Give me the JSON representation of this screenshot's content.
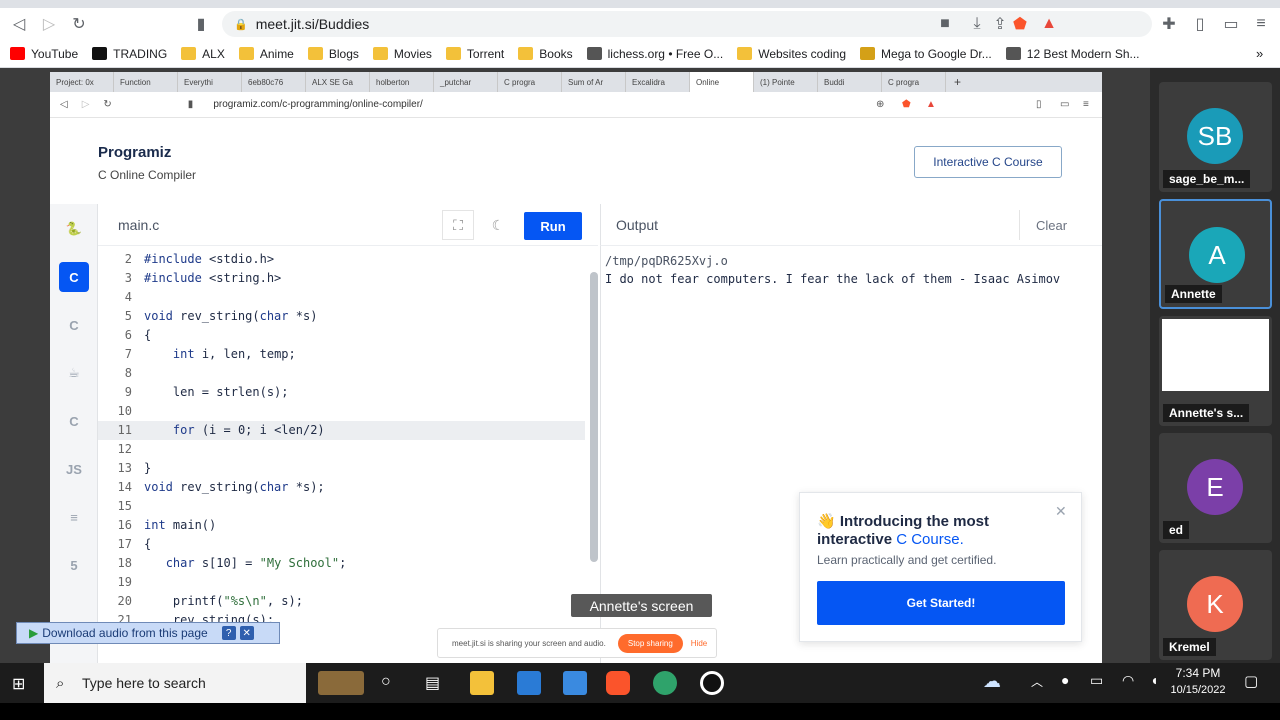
{
  "outer_browser": {
    "url": "meet.jit.si/Buddies",
    "bookmarks": [
      "YouTube",
      "TRADING",
      "ALX",
      "Anime",
      "Blogs",
      "Movies",
      "Torrent",
      "Books",
      "lichess.org • Free O...",
      "Websites coding",
      "Mega to Google Dr...",
      "12 Best Modern Sh..."
    ],
    "bookmark_colors": [
      "#ff0000",
      "#111111",
      "folder",
      "folder",
      "folder",
      "folder",
      "folder",
      "folder",
      "#555555",
      "folder",
      "#d4a017",
      "#555555"
    ]
  },
  "inner_browser": {
    "tabs": [
      "Project: 0x",
      "Function",
      "Everythi",
      "6eb80c76",
      "ALX SE Ga",
      "holberton",
      "_putchar",
      "C progra",
      "Sum of Ar",
      "Excalidra",
      "Online",
      "(1) Pointe",
      "Buddi",
      "C progra"
    ],
    "active_tab_index": 10,
    "url": "programiz.com/c-programming/online-compiler/"
  },
  "programiz": {
    "logo": "Programiz",
    "subtitle": "C Online Compiler",
    "course_button": "Interactive C Course",
    "file_name": "main.c",
    "run_label": "Run",
    "output_label": "Output",
    "clear_label": "Clear",
    "lang_icons": [
      "python-icon",
      "c-icon",
      "cpp-icon",
      "java-icon",
      "csharp-icon",
      "js-icon",
      "sql-icon",
      "html-icon"
    ],
    "lang_glyphs": [
      "🐍",
      "C",
      "C",
      "☕",
      "C",
      "JS",
      "≡",
      "5"
    ],
    "active_lang": 1,
    "code_lines": [
      {
        "n": "2",
        "t": "#include <stdio.h>"
      },
      {
        "n": "3",
        "t": "#include <string.h>"
      },
      {
        "n": "4",
        "t": ""
      },
      {
        "n": "5",
        "t": "void rev_string(char *s)"
      },
      {
        "n": "6",
        "t": "{"
      },
      {
        "n": "7",
        "t": "    int i, len, temp;"
      },
      {
        "n": "8",
        "t": ""
      },
      {
        "n": "9",
        "t": "    len = strlen(s);"
      },
      {
        "n": "10",
        "t": ""
      },
      {
        "n": "11",
        "t": "    for (i = 0; i <len/2)"
      },
      {
        "n": "12",
        "t": ""
      },
      {
        "n": "13",
        "t": "}"
      },
      {
        "n": "14",
        "t": "void rev_string(char *s);"
      },
      {
        "n": "15",
        "t": ""
      },
      {
        "n": "16",
        "t": "int main()"
      },
      {
        "n": "17",
        "t": "{"
      },
      {
        "n": "18",
        "t": "   char s[10] = \"My School\";"
      },
      {
        "n": "19",
        "t": ""
      },
      {
        "n": "20",
        "t": "    printf(\"%s\\n\", s);"
      },
      {
        "n": "21",
        "t": "    rev_string(s);"
      }
    ],
    "highlight_line_index": 9,
    "output_lines": [
      "/tmp/pqDR625Xvj.o",
      "I do not fear computers. I fear the lack of them - Isaac Asimov"
    ],
    "promo": {
      "emoji": "👋",
      "title_lead": "Introducing the most interactive ",
      "title_accent": "C Course.",
      "subtitle": "Learn practically and get certified.",
      "button": "Get Started!"
    }
  },
  "overlays": {
    "screen_label": "Annette's screen",
    "share_text": "meet.jit.si is sharing your screen and audio.",
    "stop_sharing": "Stop sharing",
    "hide": "Hide",
    "download_audio": "Download audio from this page"
  },
  "participants": [
    {
      "initials": "SB",
      "name": "sage_be_m...",
      "color": "#1a9bb8"
    },
    {
      "initials": "A",
      "name": "Annette",
      "color": "#1aa7b8",
      "active": true
    },
    {
      "initials": "",
      "name": "Annette's s...",
      "color": "#ffffff",
      "screen": true
    },
    {
      "initials": "E",
      "name": "ed",
      "color": "#7b3fa8"
    },
    {
      "initials": "K",
      "name": "Kremel",
      "color": "#ef6b52"
    }
  ],
  "taskbar": {
    "search_placeholder": "Type here to search",
    "time": "7:34 PM",
    "date": "10/15/2022"
  }
}
